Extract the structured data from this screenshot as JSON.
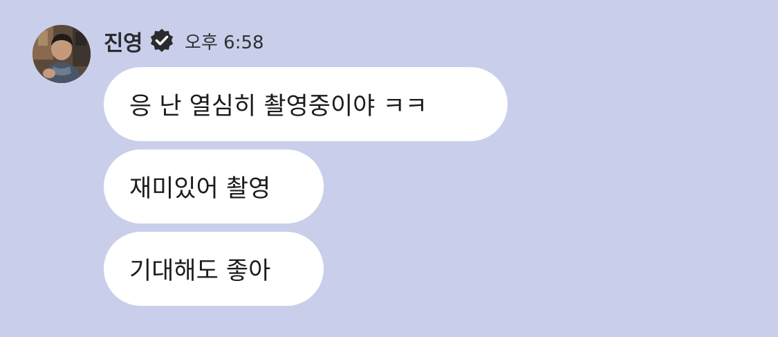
{
  "theme": {
    "background": "#c9cfea",
    "bubble": "#ffffff",
    "text": "#1c1c1e",
    "verified_badge": "#2b2b2e"
  },
  "message_group": {
    "sender": {
      "name": "진영",
      "verified": true,
      "avatar_icon": "profile-photo"
    },
    "time": "오후 6:58",
    "messages": [
      {
        "text": "응 난 열심히 촬영중이야 ㅋㅋ"
      },
      {
        "text": "재미있어 촬영"
      },
      {
        "text": "기대해도 좋아"
      }
    ]
  }
}
